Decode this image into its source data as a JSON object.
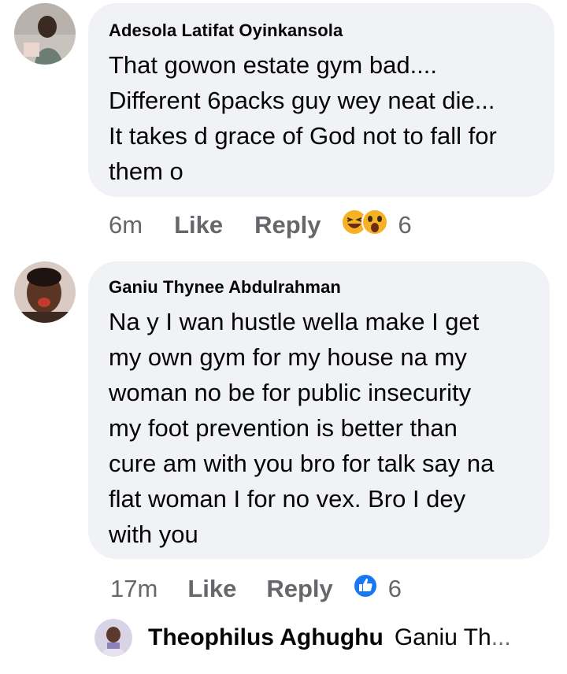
{
  "comments": [
    {
      "author": "Adesola Latifat Oyinkansola",
      "text": "That gowon estate gym bad....\nDifferent 6packs guy wey neat die...\nIt takes d grace of God not to fall for\nthem o",
      "time": "6m",
      "like_label": "Like",
      "reply_label": "Reply",
      "reactions": [
        "laugh-emoji",
        "wow-emoji"
      ],
      "reaction_count": "6"
    },
    {
      "author": "Ganiu Thynee Abdulrahman",
      "text": "Na y I wan hustle wella make I get\nmy own gym for my house na my\nwoman no be for public insecurity\nmy foot prevention is better than\ncure am with you bro for talk say na\nflat woman I for no vex. Bro I dey\nwith you",
      "time": "17m",
      "like_label": "Like",
      "reply_label": "Reply",
      "reactions": [
        "like-emoji"
      ],
      "reaction_count": "6"
    }
  ],
  "reply_preview": {
    "author": "Theophilus Aghughu",
    "preview": "Ganiu Th",
    "ellipsis": "..."
  },
  "colors": {
    "bubble": "#f0f2f5",
    "secondary_text": "#65676b",
    "like_blue": "#1877f2"
  }
}
